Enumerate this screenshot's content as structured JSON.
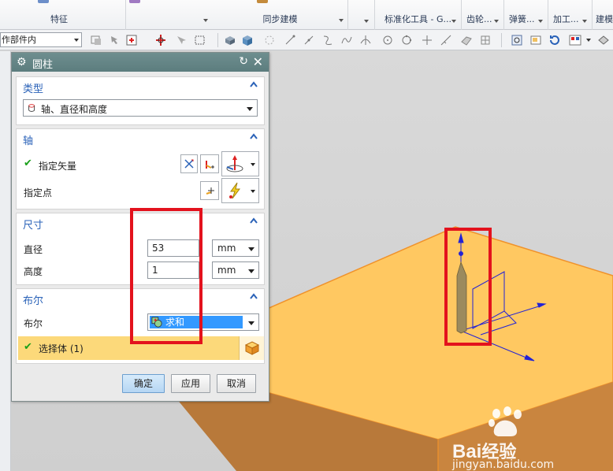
{
  "ribbon": {
    "groups": [
      "特征",
      "同步建模",
      "标准化工具 - G...",
      "齿轮...",
      "弹簧...",
      "加工...",
      "建模"
    ]
  },
  "toolbar": {
    "selection_filter": "作部件内"
  },
  "dialog": {
    "title": "圆柱",
    "type_section": {
      "label": "类型",
      "value": "轴、直径和高度"
    },
    "axis_section": {
      "label": "轴",
      "specify_vector": "指定矢量",
      "specify_point": "指定点"
    },
    "dims_section": {
      "label": "尺寸",
      "diameter_label": "直径",
      "diameter_value": "53",
      "diameter_unit": "mm",
      "height_label": "高度",
      "height_value": "1",
      "height_unit": "mm"
    },
    "boolean_section": {
      "label": "布尔",
      "boolean_label": "布尔",
      "boolean_value": "求和",
      "select_body": "选择体 (1)"
    },
    "buttons": {
      "ok": "确定",
      "apply": "应用",
      "cancel": "取消"
    }
  },
  "watermark": {
    "brand": "Bai",
    "brand2": "经验",
    "url": "jingyan.baidu.com"
  },
  "colors": {
    "highlight_box": "#e3121d",
    "solid_top": "#ffc861",
    "solid_side": "#b57a3a",
    "title_bar": "#5f7f80"
  }
}
